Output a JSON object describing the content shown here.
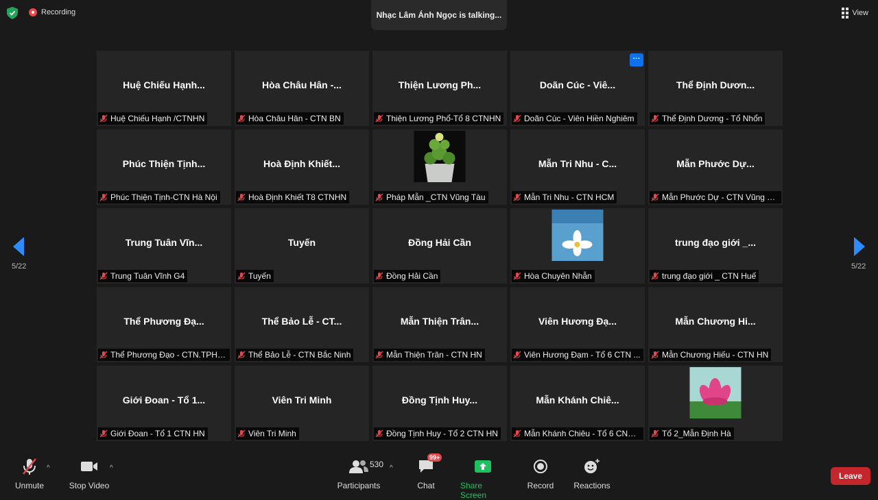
{
  "topbar": {
    "recording_label": "Recording",
    "talking_text": "Nhạc Lâm Ánh Ngọc is talking...",
    "view_label": "View"
  },
  "gallery": {
    "page_indicator_left": "5/22",
    "page_indicator_right": "5/22",
    "tiles": [
      {
        "big_name": "Huệ Chiếu Hạnh...",
        "name": "Huệ Chiếu Hạnh /CTNHN"
      },
      {
        "big_name": "Hòa Châu Hân -...",
        "name": "Hòa Châu Hân - CTN BN"
      },
      {
        "big_name": "Thiện Lương Ph...",
        "name": "Thiện Lương Phổ-Tổ 8 CTNHN"
      },
      {
        "big_name": "Doãn Cúc -  Viê...",
        "name": "Doãn Cúc -  Viên Hiền Nghiêm",
        "more": "···"
      },
      {
        "big_name": "Thể Định Dươn...",
        "name": "Thể Định Dương - Tổ Nhổn"
      },
      {
        "big_name": "Phúc Thiện Tịnh...",
        "name": "Phúc Thiện Tịnh-CTN Hà Nội"
      },
      {
        "big_name": "Hoà Định Khiết...",
        "name": "Hoà Định Khiết T8 CTNHN"
      },
      {
        "big_name": "",
        "name": "Pháp Mẫn _CTN Vũng Tàu",
        "image": "cactus-photo"
      },
      {
        "big_name": "Mẫn Tri Nhu - C...",
        "name": "Mẫn Tri Nhu - CTN HCM"
      },
      {
        "big_name": "Mẫn Phước Dự...",
        "name": "Mẫn Phước Dự - CTN Vũng Tàu"
      },
      {
        "big_name": "Trung Tuân Vĩn...",
        "name": "Trung Tuân Vĩnh G4"
      },
      {
        "big_name": "Tuyến",
        "name": "Tuyến"
      },
      {
        "big_name": "Đồng Hải Cần",
        "name": "Đồng Hải Cần"
      },
      {
        "big_name": "",
        "name": "Hòa Chuyên Nhẫn",
        "image": "white-flower-photo"
      },
      {
        "big_name": "trung đạo giới _...",
        "name": "trung đạo giới _ CTN Huế"
      },
      {
        "big_name": "Thể Phương Đạ...",
        "name": "Thể Phương Đạo -  CTN.TPHC..."
      },
      {
        "big_name": "Thể Bảo Lễ - CT...",
        "name": "Thể Bảo Lễ - CTN Bắc Ninh"
      },
      {
        "big_name": "Mẫn Thiện Trân...",
        "name": "Mẫn Thiện Trân - CTN HN"
      },
      {
        "big_name": "Viên Hương Đạ...",
        "name": "Viên Hương Đạm - Tổ 6 CTN ..."
      },
      {
        "big_name": "Mẫn Chương Hi...",
        "name": "Mẫn Chương Hiếu - CTN HN"
      },
      {
        "big_name": "Giới Đoan - Tổ 1...",
        "name": "Giới Đoan - Tổ 1 CTN HN"
      },
      {
        "big_name": "Viên Tri Minh",
        "name": "Viên Tri Minh"
      },
      {
        "big_name": "Đồng Tịnh Huy...",
        "name": "Đồng Tịnh Huy - Tổ 2 CTN HN"
      },
      {
        "big_name": "Mẫn Khánh Chiê...",
        "name": "Mẫn Khánh Chiêu - Tổ 6 CNT ..."
      },
      {
        "big_name": "",
        "name": "Tổ 2_Mẫn Định Hà",
        "image": "pink-lotus-photo"
      }
    ]
  },
  "toolbar": {
    "unmute_label": "Unmute",
    "stop_video_label": "Stop Video",
    "participants_label": "Participants",
    "participants_count": "530",
    "chat_label": "Chat",
    "chat_badge": "99+",
    "share_screen_label": "Share Screen",
    "record_label": "Record",
    "reactions_label": "Reactions",
    "leave_label": "Leave"
  },
  "colors": {
    "background": "#1a1a1a",
    "tile": "#252525",
    "accent_blue": "#0e72ed",
    "share_green": "#1ec15f",
    "leave_red": "#c4262c",
    "muted_red": "#e5484d",
    "arrow_blue": "#2d8cff"
  }
}
